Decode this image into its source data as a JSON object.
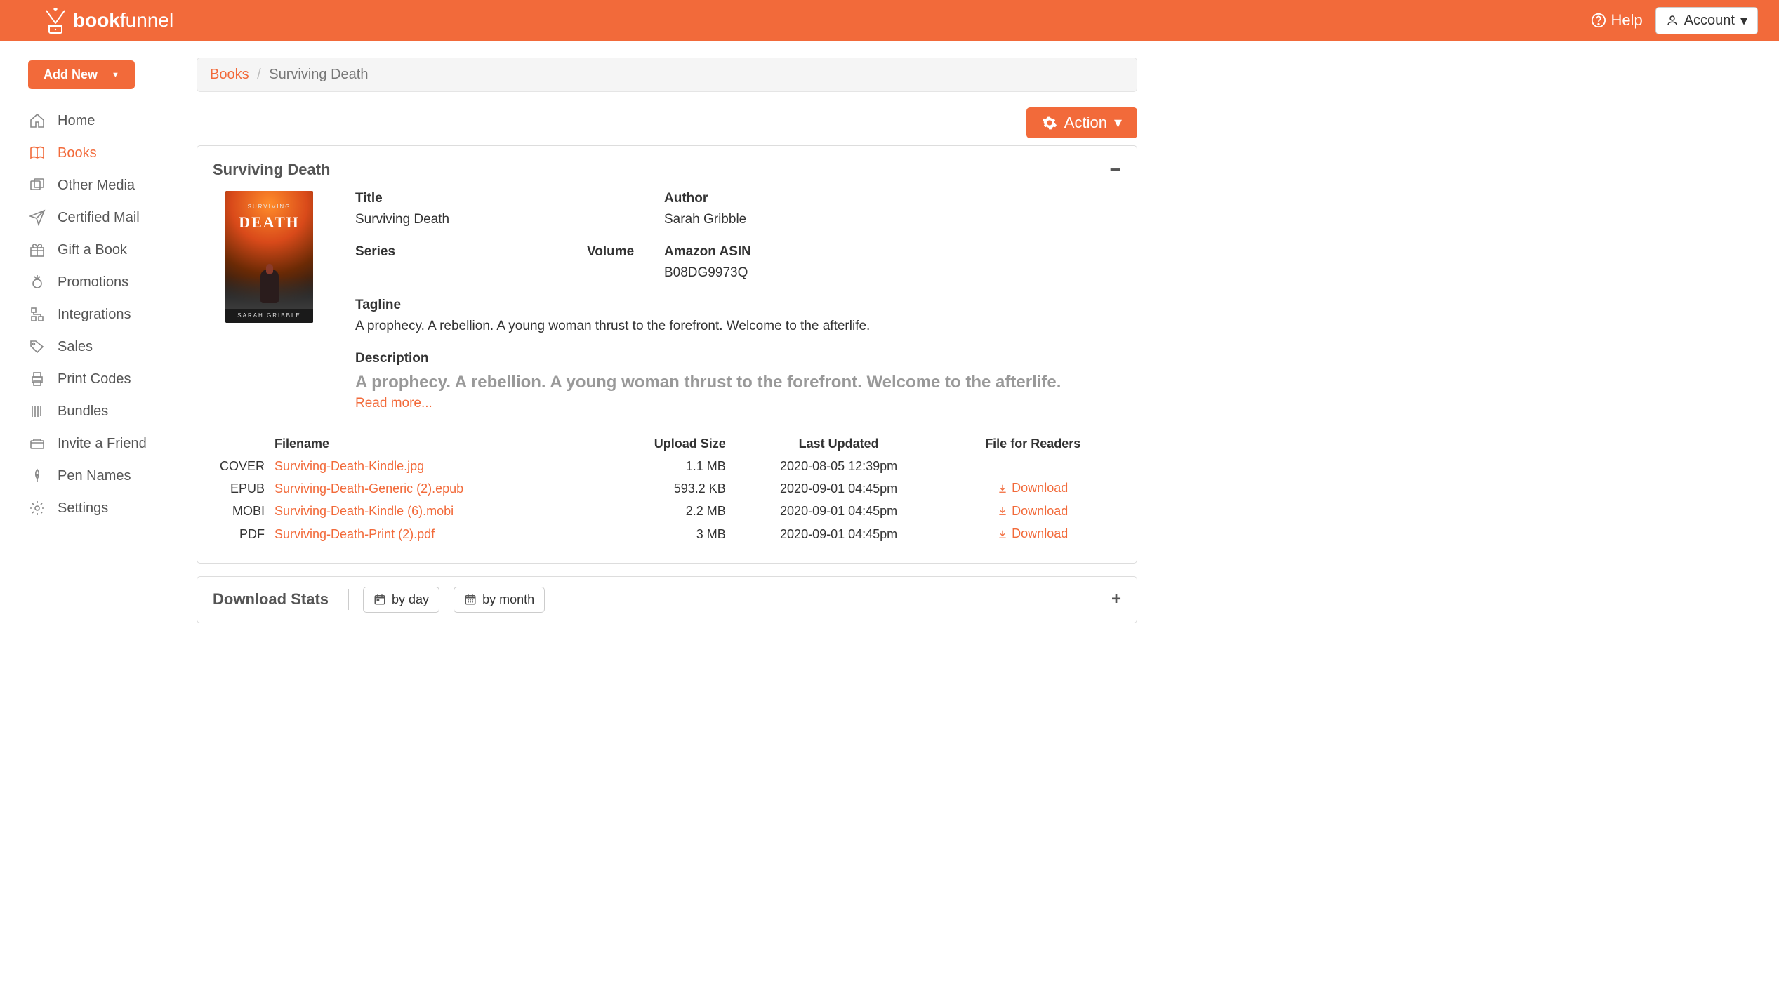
{
  "header": {
    "brand_a": "book",
    "brand_b": "funnel",
    "help_label": "Help",
    "account_label": "Account"
  },
  "sidebar": {
    "add_new_label": "Add New",
    "items": [
      {
        "label": "Home",
        "icon": "home"
      },
      {
        "label": "Books",
        "icon": "book",
        "active": true
      },
      {
        "label": "Other Media",
        "icon": "media"
      },
      {
        "label": "Certified Mail",
        "icon": "send"
      },
      {
        "label": "Gift a Book",
        "icon": "gift"
      },
      {
        "label": "Promotions",
        "icon": "promo"
      },
      {
        "label": "Integrations",
        "icon": "integrations"
      },
      {
        "label": "Sales",
        "icon": "sales"
      },
      {
        "label": "Print Codes",
        "icon": "print"
      },
      {
        "label": "Bundles",
        "icon": "bundles"
      },
      {
        "label": "Invite a Friend",
        "icon": "invite"
      },
      {
        "label": "Pen Names",
        "icon": "pen"
      },
      {
        "label": "Settings",
        "icon": "settings"
      }
    ]
  },
  "breadcrumb": {
    "root": "Books",
    "current": "Surviving Death"
  },
  "action_button_label": "Action",
  "book": {
    "panel_title": "Surviving Death",
    "labels": {
      "title": "Title",
      "author": "Author",
      "series": "Series",
      "volume": "Volume",
      "asin": "Amazon ASIN",
      "tagline": "Tagline",
      "description": "Description",
      "read_more": "Read more..."
    },
    "title": "Surviving Death",
    "author": "Sarah Gribble",
    "series": "",
    "volume": "",
    "asin": "B08DG9973Q",
    "tagline": "A prophecy. A rebellion. A young woman thrust to the forefront. Welcome to the afterlife.",
    "description_preview": "A prophecy. A rebellion. A young woman thrust to the forefront. Welcome to the afterlife.",
    "cover": {
      "surtitle": "SURVIVING",
      "title": "DEATH",
      "author": "SARAH GRIBBLE"
    }
  },
  "files": {
    "headers": {
      "filename": "Filename",
      "upload_size": "Upload Size",
      "last_updated": "Last Updated",
      "file_for_readers": "File for Readers"
    },
    "download_label": "Download",
    "rows": [
      {
        "type": "COVER",
        "filename": "Surviving-Death-Kindle.jpg",
        "size": "1.1 MB",
        "updated": "2020-08-05 12:39pm",
        "download": false
      },
      {
        "type": "EPUB",
        "filename": "Surviving-Death-Generic (2).epub",
        "size": "593.2 KB",
        "updated": "2020-09-01 04:45pm",
        "download": true
      },
      {
        "type": "MOBI",
        "filename": "Surviving-Death-Kindle (6).mobi",
        "size": "2.2 MB",
        "updated": "2020-09-01 04:45pm",
        "download": true
      },
      {
        "type": "PDF",
        "filename": "Surviving-Death-Print (2).pdf",
        "size": "3 MB",
        "updated": "2020-09-01 04:45pm",
        "download": true
      }
    ]
  },
  "stats": {
    "title": "Download Stats",
    "by_day": "by day",
    "by_month": "by month"
  }
}
